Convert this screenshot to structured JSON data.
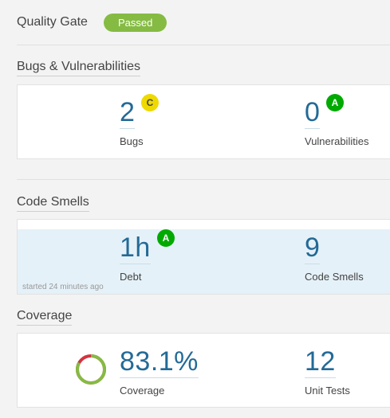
{
  "quality_gate": {
    "title": "Quality Gate",
    "status": "Passed",
    "status_color": "#85bb43"
  },
  "bugs_vulnerabilities": {
    "title": "Bugs & Vulnerabilities",
    "bugs": {
      "value": "2",
      "label": "Bugs",
      "rating": "C",
      "rating_color": "#eed900"
    },
    "vulnerabilities": {
      "value": "0",
      "label": "Vulnerabilities",
      "rating": "A",
      "rating_color": "#00aa00"
    }
  },
  "code_smells": {
    "title": "Code Smells",
    "debt": {
      "value": "1h",
      "label": "Debt",
      "rating": "A",
      "rating_color": "#00aa00"
    },
    "smells": {
      "value": "9",
      "label": "Code Smells"
    },
    "started": "started 24 minutes ago"
  },
  "coverage": {
    "title": "Coverage",
    "coverage": {
      "value": "83.1%",
      "label": "Coverage",
      "percent": 83.1,
      "covered_color": "#85bb43",
      "uncovered_color": "#d4333f"
    },
    "unit_tests": {
      "value": "12",
      "label": "Unit Tests"
    }
  }
}
